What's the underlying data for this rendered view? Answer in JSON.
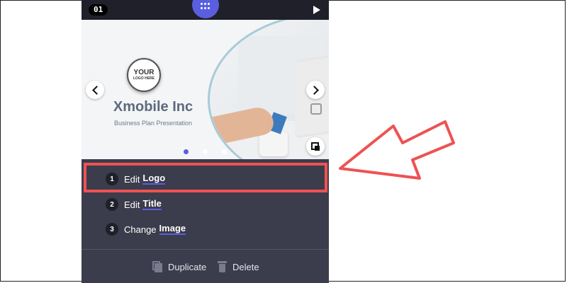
{
  "slide_number": "01",
  "icons": {
    "grid": "grid-dots-icon",
    "play": "play-icon",
    "prev": "chevron-left-icon",
    "next": "chevron-right-icon",
    "swap_image": "swap-image-icon",
    "duplicate": "duplicate-icon",
    "delete": "trash-icon"
  },
  "slide": {
    "logo_line1": "YOUR",
    "logo_line2": "LOGO HERE",
    "title": "Xmobile Inc",
    "subtitle": "Business Plan Presentation",
    "dots_active_index": 0,
    "dots_count": 3
  },
  "steps": [
    {
      "num": "1",
      "verb": "Edit",
      "object": "Logo"
    },
    {
      "num": "2",
      "verb": "Edit",
      "object": "Title"
    },
    {
      "num": "3",
      "verb": "Change",
      "object": "Image"
    }
  ],
  "actions": {
    "duplicate_label": "Duplicate",
    "delete_label": "Delete"
  },
  "colors": {
    "accent": "#5a5fe0",
    "highlight": "#ee5253",
    "panel_bg": "#3b3c4c"
  }
}
